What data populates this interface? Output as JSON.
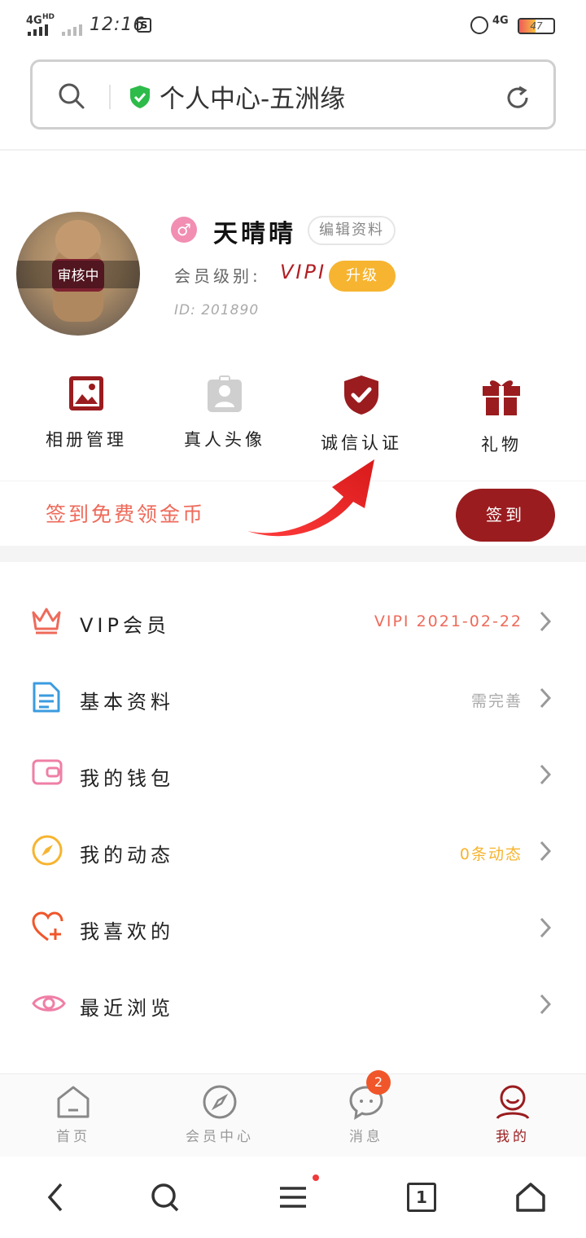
{
  "status_bar": {
    "network_left": "4G",
    "network_sup": "HD",
    "time": "12:16",
    "network_right": "4G",
    "battery": "47"
  },
  "address_bar": {
    "title": "个人中心-五洲缘"
  },
  "profile": {
    "avatar_status": "审核中",
    "gender_symbol": "♂",
    "nickname": "天晴晴",
    "edit_label": "编辑资料",
    "level_label": "会员级别:",
    "level_value": "VIPI",
    "upgrade_label": "升级",
    "id_text": "ID: 201890"
  },
  "quick_actions": [
    {
      "label": "相册管理",
      "icon": "photo-icon"
    },
    {
      "label": "真人头像",
      "icon": "badge-person-icon"
    },
    {
      "label": "诚信认证",
      "icon": "shield-check-icon"
    },
    {
      "label": "礼物",
      "icon": "gift-icon"
    }
  ],
  "sign_in": {
    "text": "签到免费领金币",
    "button": "签到"
  },
  "menu": [
    {
      "label": "VIP会员",
      "value": "VIPI 2021-02-22",
      "value_color": "#ee6a5a",
      "icon": "crown-icon"
    },
    {
      "label": "基本资料",
      "value": "需完善",
      "value_color": "#aaaaaa",
      "icon": "document-icon"
    },
    {
      "label": "我的钱包",
      "value": "",
      "value_color": "#aaaaaa",
      "icon": "wallet-icon"
    },
    {
      "label": "我的动态",
      "value": "0条动态",
      "value_color": "#f6b430",
      "icon": "compass-icon"
    },
    {
      "label": "我喜欢的",
      "value": "",
      "value_color": "#aaaaaa",
      "icon": "heart-plus-icon"
    },
    {
      "label": "最近浏览",
      "value": "",
      "value_color": "#aaaaaa",
      "icon": "eye-icon"
    }
  ],
  "tabs": [
    {
      "label": "首页",
      "icon": "home-icon"
    },
    {
      "label": "会员中心",
      "icon": "compass-icon"
    },
    {
      "label": "消息",
      "icon": "chat-icon",
      "badge": "2"
    },
    {
      "label": "我的",
      "icon": "user-icon"
    }
  ],
  "browser_nav": {
    "tab_count": "1"
  },
  "colors": {
    "brand": "#9a1c1f",
    "accent_orange": "#f6b430",
    "accent_coral": "#ee6a5a"
  }
}
